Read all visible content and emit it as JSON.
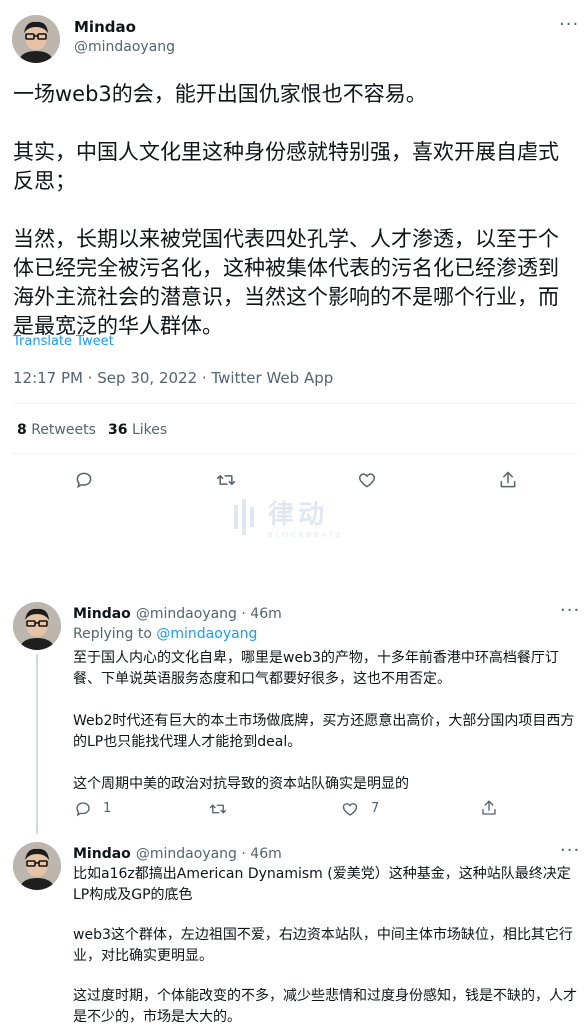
{
  "main": {
    "name": "Mindao",
    "handle": "@mindaoyang",
    "paragraphs": [
      "一场web3的会，能开出国仇家恨也不容易。",
      "其实，中国人文化里这种身份感就特别强，喜欢开展自虐式反思；",
      "当然，长期以来被党国代表四处孔学、人才渗透，以至于个体已经完全被污名化，这种被集体代表的污名化已经渗透到海外主流社会的潜意识，当然这个影响的不是哪个行业，而是最宽泛的华人群体。"
    ],
    "translate_label": "Translate Tweet",
    "timestamp": "12:17 PM · Sep 30, 2022 · Twitter Web App",
    "retweets_count": "8",
    "retweets_label": "Retweets",
    "likes_count": "36",
    "likes_label": "Likes"
  },
  "watermark": {
    "brand": "律动",
    "sub": "BLOCKBEATS"
  },
  "replies": [
    {
      "name": "Mindao",
      "meta": "@mindaoyang · 46m",
      "replying_prefix": "Replying to",
      "replying_handle": "@mindaoyang",
      "paragraphs": [
        "至于国人内心的文化自卑，哪里是web3的产物，十多年前香港中环高档餐厅订餐、下单说英语服务态度和口气都要好很多，这也不用否定。",
        "Web2时代还有巨大的本土市场做底牌，买方还愿意出高价，大部分国内项目西方的LP也只能找代理人才能抢到deal。",
        "这个周期中美的政治对抗导致的资本站队确实是明显的"
      ],
      "reply_count": "1",
      "like_count": "7"
    },
    {
      "name": "Mindao",
      "meta": "@mindaoyang · 46m",
      "paragraphs": [
        "比如a16z都搞出American Dynamism (爱美党）这种基金，这种站队最终决定LP构成及GP的底色",
        "web3这个群体，左边祖国不爱，右边资本站队，中间主体市场缺位，相比其它行业，对比确实更明显。",
        "这过度时期，个体能改变的不多，减少些悲情和过度身份感知，钱是不缺的，人才是不少的，市场是大大的。"
      ]
    }
  ],
  "colors": {
    "accent": "#1d9bf0",
    "text": "#0f1419",
    "muted": "#536471",
    "divider": "#eff3f4"
  }
}
